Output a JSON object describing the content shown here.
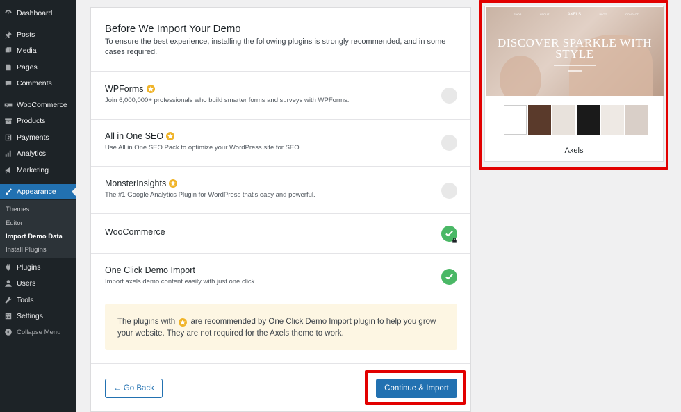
{
  "sidebar": {
    "items": [
      {
        "label": "Dashboard",
        "icon": "dashboard-icon"
      },
      {
        "label": "Posts",
        "icon": "pin-icon"
      },
      {
        "label": "Media",
        "icon": "media-icon"
      },
      {
        "label": "Pages",
        "icon": "page-icon"
      },
      {
        "label": "Comments",
        "icon": "comment-icon"
      },
      {
        "label": "WooCommerce",
        "icon": "woocommerce-icon"
      },
      {
        "label": "Products",
        "icon": "archive-icon"
      },
      {
        "label": "Payments",
        "icon": "dollar-icon"
      },
      {
        "label": "Analytics",
        "icon": "bar-chart-icon"
      },
      {
        "label": "Marketing",
        "icon": "megaphone-icon"
      },
      {
        "label": "Appearance",
        "icon": "paintbrush-icon"
      },
      {
        "label": "Plugins",
        "icon": "plugin-icon"
      },
      {
        "label": "Users",
        "icon": "user-icon"
      },
      {
        "label": "Tools",
        "icon": "wrench-icon"
      },
      {
        "label": "Settings",
        "icon": "settings-icon"
      }
    ],
    "submenu": [
      "Themes",
      "Editor",
      "Import Demo Data",
      "Install Plugins"
    ],
    "collapse_label": "Collapse Menu"
  },
  "main": {
    "title": "Before We Import Your Demo",
    "subtitle": "To ensure the best experience, installing the following plugins is strongly recommended, and in some cases required.",
    "plugins": [
      {
        "name": "WPForms",
        "description": "Join 6,000,000+ professionals who build smarter forms and surveys with WPForms.",
        "recommended": true,
        "status": "unchecked"
      },
      {
        "name": "All in One SEO",
        "description": "Use All in One SEO Pack to optimize your WordPress site for SEO.",
        "recommended": true,
        "status": "unchecked"
      },
      {
        "name": "MonsterInsights",
        "description": "The #1 Google Analytics Plugin for WordPress that's easy and powerful.",
        "recommended": true,
        "status": "unchecked"
      },
      {
        "name": "WooCommerce",
        "description": "",
        "recommended": false,
        "status": "required"
      },
      {
        "name": "One Click Demo Import",
        "description": "Import axels demo content easily with just one click.",
        "recommended": false,
        "status": "checked"
      }
    ],
    "notice": {
      "before_icon": "The plugins with",
      "after_icon": "are recommended by One Click Demo Import plugin to help you grow your website. They are not required for the Axels theme to work."
    },
    "back_label": "← Go Back",
    "continue_label": "Continue & Import"
  },
  "preview": {
    "hero_text": "DISCOVER SPARKLE WITH STYLE",
    "brand": "AXELS",
    "nav": [
      "SHOP",
      "ABOUT",
      "BLOG",
      "CONTACT"
    ],
    "theme_name": "Axels"
  },
  "colors": {
    "accent": "#2271b1",
    "highlight": "#e20000",
    "success": "#4ab866",
    "star": "#f0b429"
  }
}
